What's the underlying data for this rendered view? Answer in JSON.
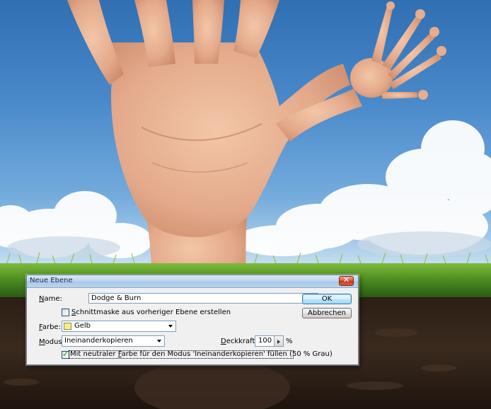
{
  "dialog": {
    "title": "Neue Ebene",
    "close_glyph": "✕",
    "name_label": "Name:",
    "name_label_key": "N",
    "name_label_rest": "ame:",
    "name_value": "Dodge & Burn",
    "clip_label_key": "S",
    "clip_label_rest": "chnittmaske aus vorheriger Ebene erstellen",
    "clip_checked": false,
    "color_label_key": "F",
    "color_label_rest": "arbe:",
    "color_value": "Gelb",
    "color_swatch": "#f6f079",
    "mode_label_key": "M",
    "mode_label_rest": "odus:",
    "mode_value": "Ineinanderkopieren",
    "opacity_label_key": "D",
    "opacity_label_rest": "eckkraft:",
    "opacity_value": "100",
    "opacity_unit": "%",
    "fill_label_a": "Mit neutraler ",
    "fill_label_key": "F",
    "fill_label_b": "arbe für den Modus 'Ineinanderkopieren' füllen (50 % Grau)",
    "fill_checked": true,
    "ok_label": "OK",
    "cancel_label": "Abbrechen"
  },
  "colors": {
    "titlebar": "#bcd5ee",
    "dialog_bg": "#f0f0f0",
    "close_button": "#c3371d",
    "default_button": "#a7d9f5"
  }
}
